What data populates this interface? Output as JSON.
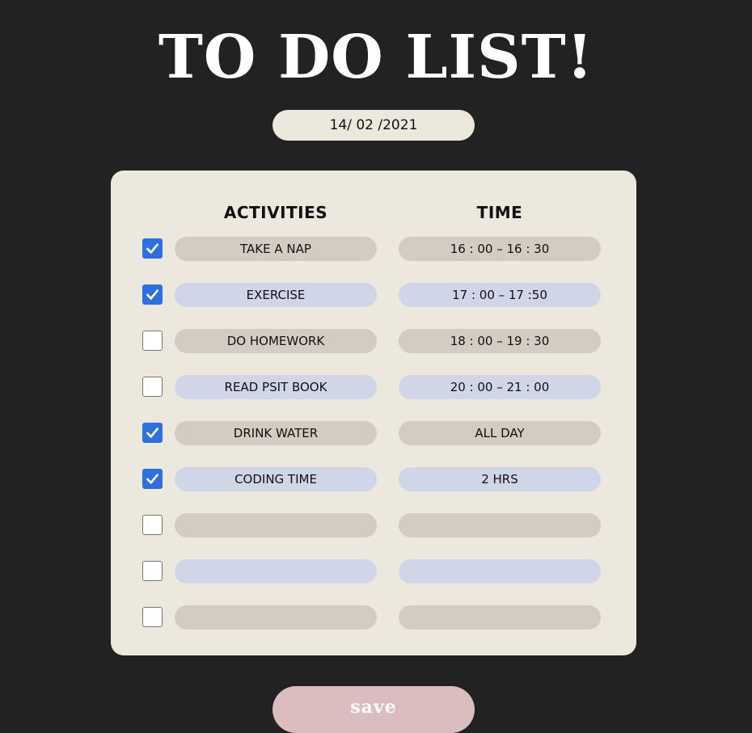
{
  "header": {
    "title": "TO DO LIST!"
  },
  "date": {
    "value": "14/ 02 /2021"
  },
  "table": {
    "activities_header": "ACTIVITIES",
    "time_header": "TIME",
    "rows": [
      {
        "checked": true,
        "activity": "TAKE A NAP",
        "time": "16 : 00 – 16 : 30"
      },
      {
        "checked": true,
        "activity": "EXERCISE",
        "time": "17 : 00 – 17 :50"
      },
      {
        "checked": false,
        "activity": "DO HOMEWORK",
        "time": "18 : 00 – 19 : 30"
      },
      {
        "checked": false,
        "activity": "READ PSIT BOOK",
        "time": "20 : 00 – 21 : 00"
      },
      {
        "checked": true,
        "activity": "DRINK WATER",
        "time": "ALL DAY"
      },
      {
        "checked": true,
        "activity": "CODING TIME",
        "time": "2 HRS"
      },
      {
        "checked": false,
        "activity": "",
        "time": ""
      },
      {
        "checked": false,
        "activity": "",
        "time": ""
      },
      {
        "checked": false,
        "activity": "",
        "time": ""
      }
    ]
  },
  "save": {
    "label": "save"
  },
  "colors": {
    "background": "#222222",
    "card": "#ede8de",
    "pill_tan": "#d4cbc2",
    "pill_blue": "#d0d5e8",
    "checkbox_checked": "#2f6fe0",
    "save_button": "#dbbcbf"
  }
}
